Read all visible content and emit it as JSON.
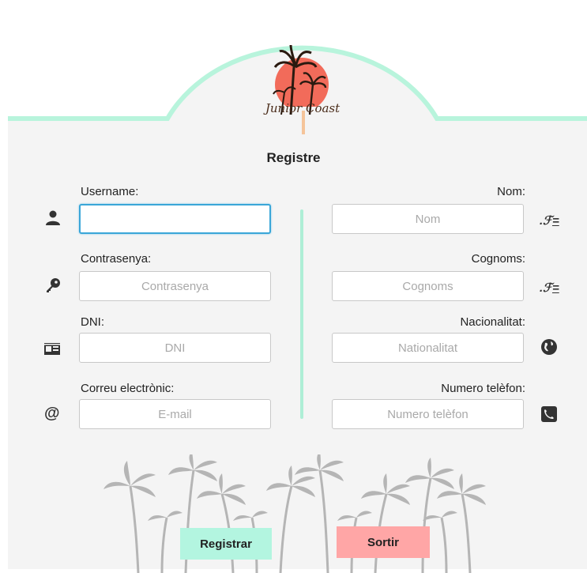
{
  "brand": {
    "logo_text": "Junior Coast"
  },
  "form": {
    "title": "Registre",
    "left": [
      {
        "label": "Username:",
        "placeholder": "",
        "icon": "user-icon"
      },
      {
        "label": "Contrasenya:",
        "placeholder": "Contrasenya",
        "icon": "key-icon"
      },
      {
        "label": "DNI:",
        "placeholder": "DNI",
        "icon": "id-card-icon"
      },
      {
        "label": "Correu electrònic:",
        "placeholder": "E-mail",
        "icon": "at-sign-icon"
      }
    ],
    "right": [
      {
        "label": "Nom:",
        "placeholder": "Nom",
        "icon": "signature-icon"
      },
      {
        "label": "Cognoms:",
        "placeholder": "Cognoms",
        "icon": "signature-icon"
      },
      {
        "label": "Nacionalitat:",
        "placeholder": "Nationalitat",
        "icon": "globe-icon"
      },
      {
        "label": "Numero telèfon:",
        "placeholder": "Numero telèfon",
        "icon": "phone-icon"
      }
    ]
  },
  "buttons": {
    "register": "Registrar",
    "exit": "Sortir"
  },
  "colors": {
    "accent_mint": "#b8f4dc",
    "register_bg": "#b3f5e0",
    "exit_bg": "#ffa6a6",
    "panel_bg": "#f4f4f4",
    "divider": "#aeeed6"
  }
}
